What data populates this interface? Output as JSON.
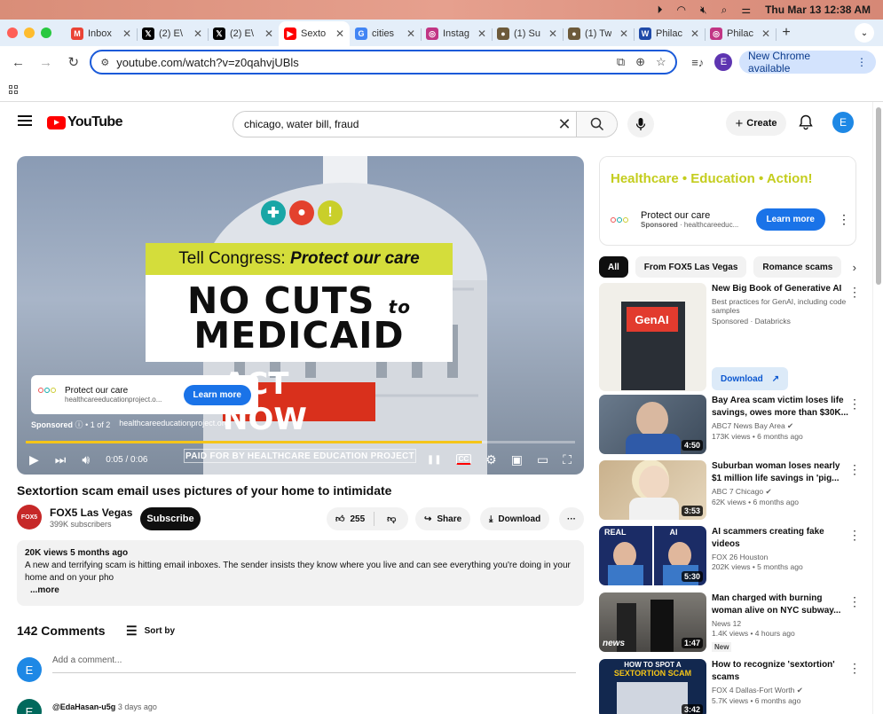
{
  "menubar": {
    "date_time": "Thu Mar 13  12:38 AM"
  },
  "tabs": [
    {
      "label": "Inbox",
      "favicon": "gmail",
      "color": "#ea4335",
      "glyph": "M"
    },
    {
      "label": "(2) E\\",
      "favicon": "x",
      "color": "#000000",
      "glyph": "𝕏"
    },
    {
      "label": "(2) E\\",
      "favicon": "x",
      "color": "#000000",
      "glyph": "𝕏"
    },
    {
      "label": "Sexto",
      "favicon": "youtube",
      "color": "#ff0000",
      "glyph": "▶",
      "active": true
    },
    {
      "label": "cities",
      "favicon": "google",
      "color": "#4285f4",
      "glyph": "G"
    },
    {
      "label": "Instag",
      "favicon": "instagram",
      "color": "#c13584",
      "glyph": "◎"
    },
    {
      "label": "(1) Su",
      "favicon": "generic",
      "color": "#6d5a3a",
      "glyph": "●"
    },
    {
      "label": "(1) Tw",
      "favicon": "generic",
      "color": "#6d5a3a",
      "glyph": "●"
    },
    {
      "label": "Philac",
      "favicon": "wikipedia",
      "color": "#1f4aa8",
      "glyph": "W"
    },
    {
      "label": "Philac",
      "favicon": "instagram",
      "color": "#c13584",
      "glyph": "◎"
    }
  ],
  "toolbar": {
    "url": "youtube.com/watch?v=z0qahvjUBls",
    "update_label": "New Chrome available",
    "profile_letter": "E"
  },
  "yt": {
    "logo_text": "YouTube",
    "search_query": "chicago, water bill, fraud",
    "create_label": "Create",
    "avatar_letter": "E"
  },
  "player": {
    "ad_headline_top_plain": "Tell Congress: ",
    "ad_headline_top_italic": "Protect our care",
    "ad_line1": "NO CUTS",
    "ad_line1_small": "to",
    "ad_line2": "MEDICAID",
    "act_now": "ACT NOW",
    "ad_card_title": "Protect our care",
    "ad_card_url": "healthcareeducationproject.o...",
    "ad_card_cta": "Learn more",
    "sponsored_label": "Sponsored",
    "ad_counter": "• 1 of 2",
    "sponsored_domain": "healthcareeducationproject.org",
    "time": "0:05 / 0:06",
    "progress_fraction": 0.83,
    "paid_by": "PAID FOR BY HEALTHCARE EDUCATION PROJECT",
    "cc_label": "CC"
  },
  "video": {
    "title": "Sextortion scam email uses pictures of your home to intimidate",
    "channel_name": "FOX5 Las Vegas",
    "channel_avatar_text": "FOX5",
    "subscribers": "399K subscribers",
    "subscribe_label": "Subscribe",
    "likes": "255",
    "share_label": "Share",
    "download_label": "Download",
    "views_age": "20K views  5 months ago",
    "description": "A new and terrifying scam is hitting email inboxes. The sender insists they know where you live and can see everything you're doing in your home and on your pho",
    "more_label": "...more"
  },
  "comments": {
    "count_label": "142 Comments",
    "sort_label": "Sort by",
    "my_letter": "E",
    "add_placeholder": "Add a comment...",
    "first_user": "@EdaHasan-u5g",
    "first_age": "3 days ago",
    "first_letter": "E"
  },
  "side_ad": {
    "hero": "Healthcare • Education • Action!",
    "title": "Protect our care",
    "sponsored": "Sponsored",
    "domain": "· healthcareeduc...",
    "cta": "Learn more"
  },
  "chips": [
    "All",
    "From FOX5 Las Vegas",
    "Romance scams"
  ],
  "recommendations": [
    {
      "title": "New Big Book of Generative AI",
      "line2": "Best practices for GenAI, including code samples",
      "channel": "Sponsored · Databricks",
      "views": "",
      "duration": "",
      "thumb": "genai",
      "cta": "Download"
    },
    {
      "title": "Bay Area scam victim loses life savings, owes more than $30K...",
      "channel": "ABC7 News Bay Area ✔",
      "views": "173K views • 6 months ago",
      "duration": "4:50",
      "thumb": "man"
    },
    {
      "title": "Suburban woman loses nearly $1 million life savings in 'pig...",
      "channel": "ABC 7 Chicago ✔",
      "views": "62K views • 6 months ago",
      "duration": "3:53",
      "thumb": "woman"
    },
    {
      "title": "AI scammers creating fake videos",
      "channel": "FOX 26 Houston",
      "views": "202K views • 5 months ago",
      "duration": "5:30",
      "thumb": "realai"
    },
    {
      "title": "Man charged with burning woman alive on NYC subway...",
      "channel": "News 12",
      "views": "1.4K views • 4 hours ago",
      "duration": "1:47",
      "thumb": "news",
      "badge": "New"
    },
    {
      "title": "How to recognize 'sextortion' scams",
      "channel": "FOX 4 Dallas-Fort Worth ✔",
      "views": "5.7K views • 6 months ago",
      "duration": "3:42",
      "thumb": "spot"
    }
  ],
  "colors": {
    "yt_red": "#ff0000",
    "accent_blue": "#1a73e8",
    "ad_lime": "#d4dd3b",
    "act_red": "#d9301c"
  }
}
